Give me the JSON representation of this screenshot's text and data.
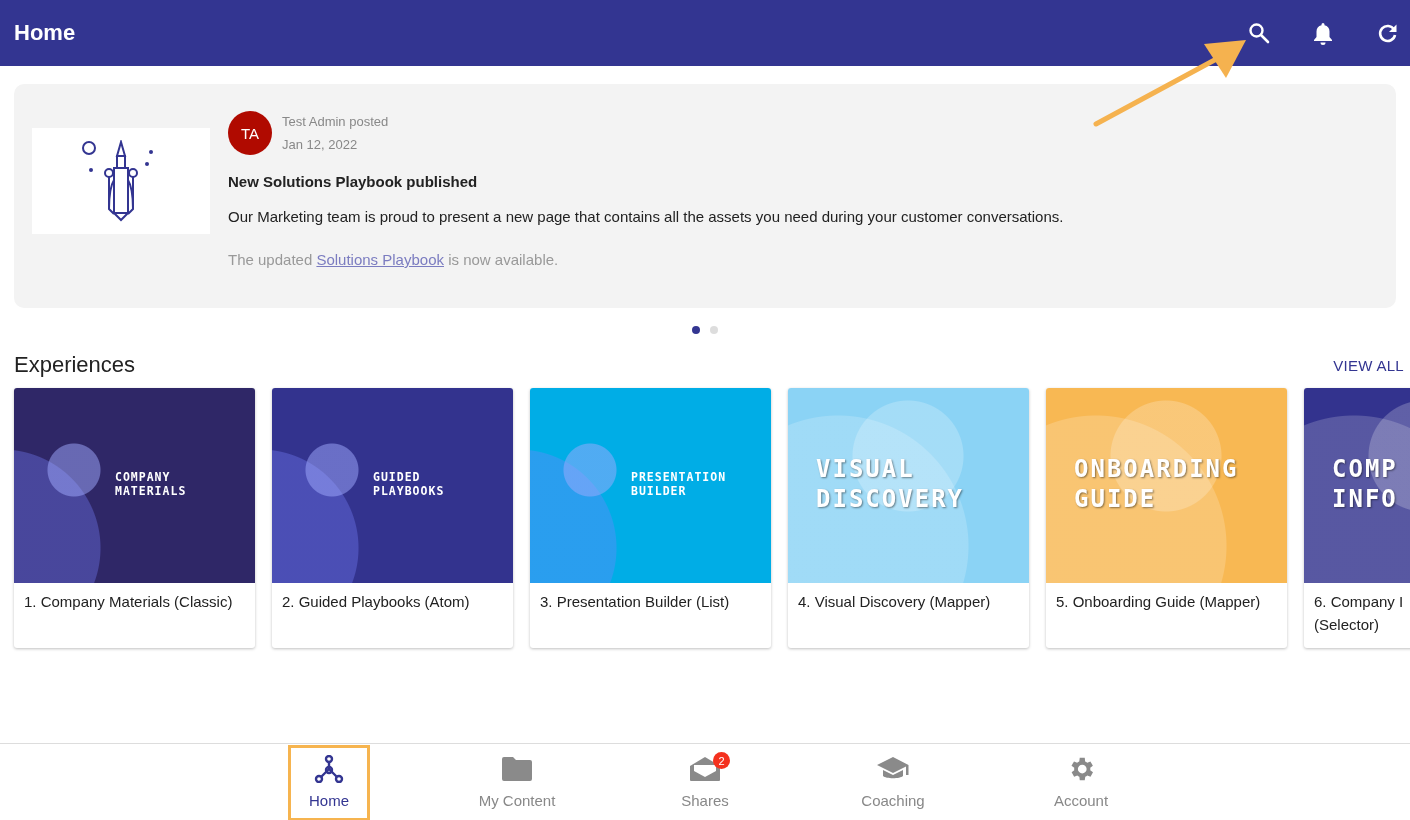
{
  "header": {
    "title": "Home"
  },
  "post": {
    "author_initials": "TA",
    "author_line": "Test Admin posted",
    "date": "Jan 12, 2022",
    "title": "New Solutions Playbook published",
    "body": "Our Marketing team is proud to present a new page that contains all the assets you need during your customer conversations.",
    "note": {
      "before": "The updated ",
      "link": "Solutions Playbook",
      "after": " is now available."
    }
  },
  "carousel_dots": [
    {
      "selected": true
    },
    {
      "selected": false
    }
  ],
  "experiences": {
    "heading": "Experiences",
    "view_all": "VIEW ALL",
    "cards": [
      {
        "kind": "small",
        "color": "#2f2767",
        "cover_title": "COMPANY\nMATERIALS",
        "label": "1. Company Materials (Classic)"
      },
      {
        "kind": "small",
        "color": "#33338e",
        "cover_title": "GUIDED\nPLAYBOOKS",
        "label": "2. Guided Playbooks (Atom)"
      },
      {
        "kind": "small",
        "color": "#00ade6",
        "cover_title": "PRESENTATION\nBUILDER",
        "label": "3. Presentation Builder (List)"
      },
      {
        "kind": "large",
        "color": "#8bd3f5",
        "cover_title": "VISUAL\nDISCOVERY",
        "label": "4. Visual Discovery (Mapper)"
      },
      {
        "kind": "large",
        "color": "#f8b853",
        "cover_title": "ONBOARDING\nGUIDE",
        "label": "5. Onboarding Guide (Mapper)"
      },
      {
        "kind": "large",
        "color": "#33338e",
        "cover_title": "COMP\nINFO",
        "label": "6. Company I\n(Selector)"
      }
    ]
  },
  "bottom_nav": [
    {
      "label": "Home",
      "selected": true
    },
    {
      "label": "My Content",
      "selected": false
    },
    {
      "label": "Shares",
      "selected": false,
      "badge": "2"
    },
    {
      "label": "Coaching",
      "selected": false
    },
    {
      "label": "Account",
      "selected": false
    }
  ]
}
